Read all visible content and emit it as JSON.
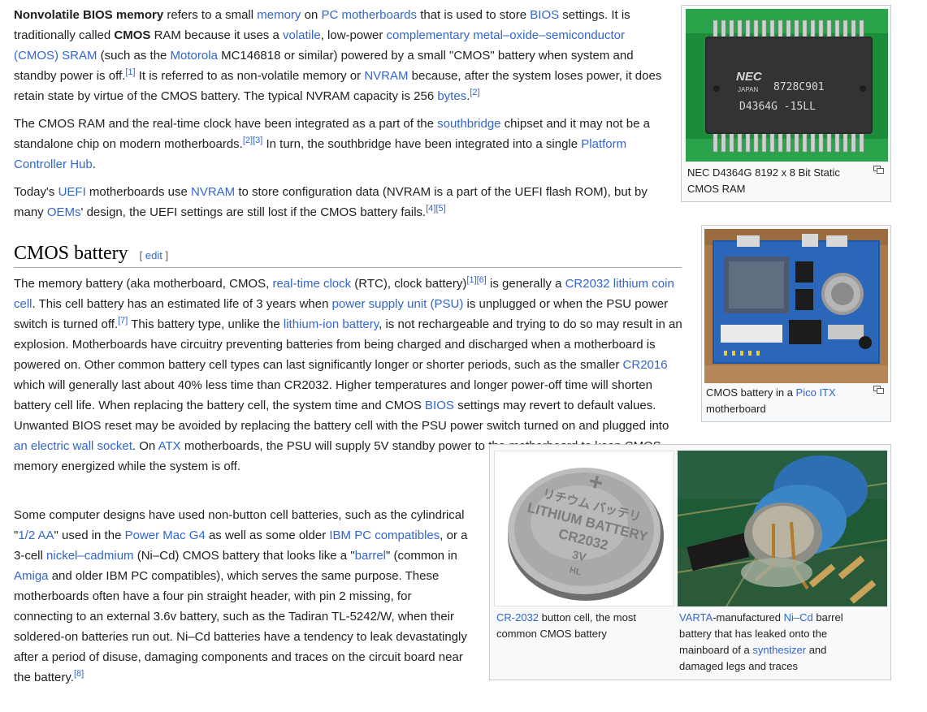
{
  "p1": [
    {
      "t": "Nonvolatile BIOS memory",
      "b": true
    },
    {
      "t": " refers to a small "
    },
    {
      "t": "memory",
      "l": true
    },
    {
      "t": " on "
    },
    {
      "t": "PC motherboards",
      "l": true
    },
    {
      "t": " that is used to store "
    },
    {
      "t": "BIOS",
      "l": true
    },
    {
      "t": " settings. It is traditionally called "
    },
    {
      "t": "CMOS",
      "b": true
    },
    {
      "t": " RAM because it uses a "
    },
    {
      "t": "volatile",
      "l": true
    },
    {
      "t": ", low-power "
    },
    {
      "t": "complementary metal–oxide–semiconductor (CMOS) SRAM",
      "l": true
    },
    {
      "t": " (such as the "
    },
    {
      "t": "Motorola",
      "l": true
    },
    {
      "t": " MC146818 or similar) powered by a small \"CMOS\" battery when system and standby power is off."
    },
    {
      "t": "[1]",
      "s": true
    },
    {
      "t": " It is referred to as non-volatile memory or "
    },
    {
      "t": "NVRAM",
      "l": true
    },
    {
      "t": " because, after the system loses power, it does retain state by virtue of the CMOS battery. The typical NVRAM capacity is 256 "
    },
    {
      "t": "bytes",
      "l": true
    },
    {
      "t": "."
    },
    {
      "t": "[2]",
      "s": true
    }
  ],
  "p2": [
    {
      "t": "The CMOS RAM and the real-time clock have been integrated as a part of the "
    },
    {
      "t": "southbridge",
      "l": true
    },
    {
      "t": " chipset and it may not be a standalone chip on modern motherboards."
    },
    {
      "t": "[2]",
      "s": true
    },
    {
      "t": "[3]",
      "s": true
    },
    {
      "t": " In turn, the southbridge have been integrated into a single "
    },
    {
      "t": "Platform Controller Hub",
      "l": true
    },
    {
      "t": "."
    }
  ],
  "p3": [
    {
      "t": "Today's "
    },
    {
      "t": "UEFI",
      "l": true
    },
    {
      "t": " motherboards use "
    },
    {
      "t": "NVRAM",
      "l": true
    },
    {
      "t": " to store configuration data (NVRAM is a part of the UEFI flash ROM), but by many "
    },
    {
      "t": "OEMs",
      "l": true
    },
    {
      "t": "' design, the UEFI settings are still lost if the CMOS battery fails."
    },
    {
      "t": "[4]",
      "s": true
    },
    {
      "t": "[5]",
      "s": true
    }
  ],
  "heading": {
    "title": "CMOS battery",
    "edit_open": "[ ",
    "edit": "edit",
    "edit_close": " ]"
  },
  "p4": [
    {
      "t": "The memory battery (aka motherboard, CMOS, "
    },
    {
      "t": "real-time clock",
      "l": true
    },
    {
      "t": " (RTC), clock battery)"
    },
    {
      "t": "[1]",
      "s": true
    },
    {
      "t": "[6]",
      "s": true
    },
    {
      "t": " is generally a "
    },
    {
      "t": "CR2032 lithium coin cell",
      "l": true
    },
    {
      "t": ". This cell battery has an estimated life of 3 years when "
    },
    {
      "t": "power supply unit (PSU)",
      "l": true
    },
    {
      "t": " is unplugged or when the PSU power switch is turned off."
    },
    {
      "t": "[7]",
      "s": true
    },
    {
      "t": " This battery type, unlike the "
    },
    {
      "t": "lithium-ion battery",
      "l": true
    },
    {
      "t": ", is not rechargeable and trying to do so may result in an explosion. Motherboards have circuitry preventing batteries from being charged and discharged when a motherboard is powered on. Other common battery cell types can last significantly longer or shorter periods, such as the smaller "
    },
    {
      "t": "CR2016",
      "l": true
    },
    {
      "t": " which will generally last about 40% less time than CR2032. Higher temperatures and longer power-off time will shorten battery cell life. When replacing the battery cell, the system time and CMOS "
    },
    {
      "t": "BIOS",
      "l": true
    },
    {
      "t": " settings may revert to default values. Unwanted BIOS reset may be avoided by replacing the battery cell with the PSU power switch turned on and plugged into "
    },
    {
      "t": "an electric wall socket",
      "l": true
    },
    {
      "t": ". On "
    },
    {
      "t": "ATX",
      "l": true
    },
    {
      "t": " motherboards, the PSU will supply 5V standby power to the motherboard to keep CMOS memory energized while the system is off."
    }
  ],
  "p5": [
    {
      "t": "Some computer designs have used non-button cell batteries, such as the cylindrical \""
    },
    {
      "t": "1/2 AA",
      "l": true
    },
    {
      "t": "\" used in the "
    },
    {
      "t": "Power Mac G4",
      "l": true
    },
    {
      "t": " as well as some older "
    },
    {
      "t": "IBM PC compatibles",
      "l": true
    },
    {
      "t": ", or a 3-cell "
    },
    {
      "t": "nickel–cadmium",
      "l": true
    },
    {
      "t": " (Ni–Cd) CMOS battery that looks like a \""
    },
    {
      "t": "barrel",
      "l": true
    },
    {
      "t": "\" (common in "
    },
    {
      "t": "Amiga",
      "l": true
    },
    {
      "t": " and older IBM PC compatibles), which serves the same purpose. These motherboards often have a four pin straight header, with pin 2 missing, for connecting to an external 3.6v battery, such as the Tadiran TL-5242/W, when their soldered-on batteries run out. Ni–Cd batteries have a tendency to leak devastatingly after a period of disuse, damaging components and traces on the circuit board near the battery."
    },
    {
      "t": "[8]",
      "s": true
    }
  ],
  "fig1": {
    "caption": [
      {
        "t": "NEC D4364G 8192 x 8 Bit Static CMOS RAM"
      }
    ],
    "chip_text": [
      "NEC",
      "JAPAN",
      "8728C901",
      "D4364G -15LL"
    ]
  },
  "fig2": {
    "caption": [
      {
        "t": "CMOS battery in a "
      },
      {
        "t": "Pico ITX",
        "l": true
      },
      {
        "t": " motherboard"
      }
    ]
  },
  "fig3": {
    "caption": [
      {
        "t": "CR-2032",
        "l": true
      },
      {
        "t": " button cell, the most common CMOS battery"
      }
    ],
    "coin_text": [
      "リチウム バッテリ",
      "LITHIUM BATTERY",
      "CR2032",
      "3V",
      "HL"
    ]
  },
  "fig4": {
    "caption": [
      {
        "t": "VARTA",
        "l": true
      },
      {
        "t": "-manufactured "
      },
      {
        "t": "Ni–Cd",
        "l": true
      },
      {
        "t": " barrel battery that has leaked onto the mainboard of a "
      },
      {
        "t": "synthesizer",
        "l": true
      },
      {
        "t": " and damaged legs and traces"
      }
    ]
  },
  "colors": {
    "link": "#3366cc",
    "text": "#202122",
    "thumb_bg": "#f8f9fa",
    "thumb_border": "#c8ccd1"
  }
}
